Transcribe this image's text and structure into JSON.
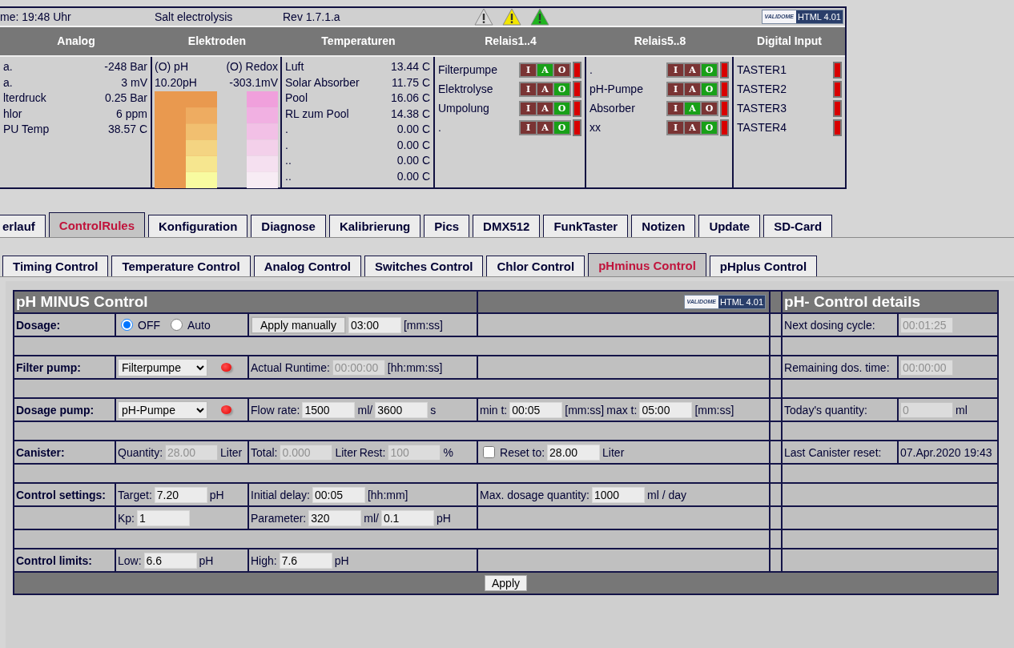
{
  "status_bar": {
    "time": "me: 19:48 Uhr",
    "title": "Salt electrolysis",
    "revision": "Rev 1.7.1.a",
    "alerts": [
      {
        "color": "#d9d9d9"
      },
      {
        "color": "#f2e600"
      },
      {
        "color": "#1fb41f"
      }
    ],
    "badge": {
      "logo": "VALIDOME",
      "version": "HTML 4.01"
    }
  },
  "panels": {
    "headers": [
      "Analog",
      "Elektroden",
      "Temperaturen",
      "Relais1..4",
      "Relais5..8",
      "Digital Input"
    ],
    "analog": [
      {
        "name": "a.",
        "value": "-248 Bar"
      },
      {
        "name": "a.",
        "value": "3 mV"
      },
      {
        "name": "lterdruck",
        "value": "0.25 Bar"
      },
      {
        "name": "hlor",
        "value": "6 ppm"
      },
      {
        "name": "PU Temp",
        "value": "38.57 C"
      }
    ],
    "electrodes": {
      "ph_label": "(O) pH",
      "redox_label": "(O) Redox",
      "ph_value": "10.20pH",
      "redox_value": "-303.1mV"
    },
    "temperatures": [
      {
        "name": "Luft",
        "value": "13.44 C"
      },
      {
        "name": "Solar Absorber",
        "value": "11.75 C"
      },
      {
        "name": "Pool",
        "value": "16.06 C"
      },
      {
        "name": "RL zum Pool",
        "value": "14.38 C"
      },
      {
        "name": ".",
        "value": "0.00 C"
      },
      {
        "name": ".",
        "value": "0.00 C"
      },
      {
        "name": "..",
        "value": "0.00 C"
      },
      {
        "name": "..",
        "value": "0.00 C"
      }
    ],
    "relays_1_4": [
      {
        "name": "Filterpumpe",
        "active": false,
        "modes": [
          {
            "label": "I",
            "selected": false
          },
          {
            "label": "A",
            "selected": true
          },
          {
            "label": "O",
            "selected": false
          }
        ]
      },
      {
        "name": "Elektrolyse",
        "active": false,
        "modes": [
          {
            "label": "I",
            "selected": false
          },
          {
            "label": "A",
            "selected": false
          },
          {
            "label": "O",
            "selected": true
          }
        ]
      },
      {
        "name": "Umpolung",
        "active": false,
        "modes": [
          {
            "label": "I",
            "selected": false
          },
          {
            "label": "A",
            "selected": false
          },
          {
            "label": "O",
            "selected": true
          }
        ]
      },
      {
        "name": ".",
        "active": false,
        "modes": [
          {
            "label": "I",
            "selected": false
          },
          {
            "label": "A",
            "selected": false
          },
          {
            "label": "O",
            "selected": true
          }
        ]
      }
    ],
    "relays_5_8": [
      {
        "name": ".",
        "active": false,
        "modes": [
          {
            "label": "I",
            "selected": false
          },
          {
            "label": "A",
            "selected": false
          },
          {
            "label": "O",
            "selected": true
          }
        ]
      },
      {
        "name": "pH-Pumpe",
        "active": false,
        "modes": [
          {
            "label": "I",
            "selected": false
          },
          {
            "label": "A",
            "selected": false
          },
          {
            "label": "O",
            "selected": true
          }
        ]
      },
      {
        "name": "Absorber",
        "active": false,
        "modes": [
          {
            "label": "I",
            "selected": false
          },
          {
            "label": "A",
            "selected": true
          },
          {
            "label": "O",
            "selected": false
          }
        ]
      },
      {
        "name": "xx",
        "active": false,
        "modes": [
          {
            "label": "I",
            "selected": false
          },
          {
            "label": "A",
            "selected": false
          },
          {
            "label": "O",
            "selected": true
          }
        ]
      }
    ],
    "digital_inputs": [
      {
        "name": "TASTER1",
        "active": false
      },
      {
        "name": "TASTER2",
        "active": false
      },
      {
        "name": "TASTER3",
        "active": false
      },
      {
        "name": "TASTER4",
        "active": false
      }
    ]
  },
  "main_tabs": [
    {
      "label": "erlauf",
      "selected": false
    },
    {
      "label": "ControlRules",
      "selected": true
    },
    {
      "label": "Konfiguration",
      "selected": false
    },
    {
      "label": "Diagnose",
      "selected": false
    },
    {
      "label": "Kalibrierung",
      "selected": false
    },
    {
      "label": "Pics",
      "selected": false
    },
    {
      "label": "DMX512",
      "selected": false
    },
    {
      "label": "FunkTaster",
      "selected": false
    },
    {
      "label": "Notizen",
      "selected": false
    },
    {
      "label": "Update",
      "selected": false
    },
    {
      "label": "SD-Card",
      "selected": false
    }
  ],
  "sub_tabs": [
    {
      "label": "Timing Control",
      "selected": false
    },
    {
      "label": "Temperature Control",
      "selected": false
    },
    {
      "label": "Analog Control",
      "selected": false
    },
    {
      "label": "Switches Control",
      "selected": false
    },
    {
      "label": "Chlor Control",
      "selected": false
    },
    {
      "label": "pHminus Control",
      "selected": true
    },
    {
      "label": "pHplus Control",
      "selected": false
    }
  ],
  "form": {
    "title": "pH MINUS Control",
    "badge": {
      "logo": "VALIDOME",
      "version": "HTML 4.01"
    },
    "details_title": "pH- Control details",
    "apply": "Apply",
    "rows": [
      {
        "kind": "fields",
        "label": "Dosage:",
        "column_2": [
          {
            "kind": "radio",
            "label": "OFF",
            "selected": true
          },
          {
            "kind": "radio",
            "label": "Auto",
            "selected": false
          }
        ],
        "column_3": [
          {
            "kind": "button",
            "label": "Apply manually"
          },
          {
            "kind": "input",
            "value": "03:00",
            "disabled": false
          },
          {
            "kind": "text",
            "text": "[mm:ss]"
          }
        ],
        "detail": {
          "label": "Next dosing cycle:",
          "items": [
            {
              "kind": "input",
              "value": "00:01:25",
              "disabled": true
            }
          ]
        }
      },
      {
        "kind": "spacer"
      },
      {
        "kind": "fields",
        "label": "Filter pump:",
        "column_2": [
          {
            "kind": "select",
            "value": "Filterpumpe"
          },
          {
            "kind": "led",
            "on": false
          }
        ],
        "column_3": [
          {
            "kind": "text",
            "text": "Actual Runtime:"
          },
          {
            "kind": "input",
            "value": "00:00:00",
            "disabled": true
          },
          {
            "kind": "text",
            "text": "[hh:mm:ss]"
          }
        ],
        "detail": {
          "label": "Remaining dos. time:",
          "items": [
            {
              "kind": "input",
              "value": "00:00:00",
              "disabled": true
            }
          ]
        }
      },
      {
        "kind": "spacer"
      },
      {
        "kind": "fields",
        "label": "Dosage pump:",
        "column_2": [
          {
            "kind": "select",
            "value": "pH-Pumpe"
          },
          {
            "kind": "led",
            "on": false
          }
        ],
        "column_3": [
          {
            "kind": "text",
            "text": "Flow rate:"
          },
          {
            "kind": "input",
            "value": "1500",
            "disabled": false
          },
          {
            "kind": "text",
            "text": "ml/"
          },
          {
            "kind": "input",
            "value": "3600",
            "disabled": false
          },
          {
            "kind": "text",
            "text": "s"
          }
        ],
        "column_4": [
          {
            "kind": "text",
            "text": "min t:"
          },
          {
            "kind": "input",
            "value": "00:05",
            "disabled": false
          },
          {
            "kind": "text",
            "text": "[mm:ss]"
          },
          {
            "kind": "text",
            "text": "max t:"
          },
          {
            "kind": "input",
            "value": "05:00",
            "disabled": false
          },
          {
            "kind": "text",
            "text": "[mm:ss]"
          }
        ],
        "detail": {
          "label": "Today's quantity:",
          "items": [
            {
              "kind": "input",
              "value": "0",
              "disabled": true
            },
            {
              "kind": "text",
              "text": "ml"
            }
          ]
        }
      },
      {
        "kind": "spacer"
      },
      {
        "kind": "fields",
        "label": "Canister:",
        "column_2": [
          {
            "kind": "text",
            "text": "Quantity:"
          },
          {
            "kind": "input",
            "value": "28.00",
            "disabled": true
          },
          {
            "kind": "text",
            "text": "Liter"
          }
        ],
        "column_3": [
          {
            "kind": "text",
            "text": "Total:"
          },
          {
            "kind": "input",
            "value": "0.000",
            "disabled": true
          },
          {
            "kind": "text",
            "text": "Liter"
          },
          {
            "kind": "text",
            "text": "Rest:"
          },
          {
            "kind": "input",
            "value": "100",
            "disabled": true
          },
          {
            "kind": "text",
            "text": "%"
          }
        ],
        "column_4": [
          {
            "kind": "checkbox",
            "checked": false
          },
          {
            "kind": "text",
            "text": "Reset to:"
          },
          {
            "kind": "input",
            "value": "28.00",
            "disabled": false
          },
          {
            "kind": "text",
            "text": "Liter"
          }
        ],
        "detail": {
          "label": "Last Canister reset:",
          "items": [
            {
              "kind": "text",
              "text": "07.Apr.2020 19:43"
            }
          ]
        }
      },
      {
        "kind": "spacer"
      },
      {
        "kind": "fields",
        "label": "Control settings:",
        "column_2": [
          {
            "kind": "text",
            "text": "Target:"
          },
          {
            "kind": "input",
            "value": "7.20",
            "disabled": false
          },
          {
            "kind": "text",
            "text": "pH"
          }
        ],
        "column_3": [
          {
            "kind": "text",
            "text": "Initial delay:"
          },
          {
            "kind": "input",
            "value": "00:05",
            "disabled": false
          },
          {
            "kind": "text",
            "text": "[hh:mm]"
          }
        ],
        "column_4": [
          {
            "kind": "text",
            "text": "Max. dosage quantity:"
          },
          {
            "kind": "input",
            "value": "1000",
            "disabled": false
          },
          {
            "kind": "text",
            "text": "ml / day"
          }
        ]
      },
      {
        "kind": "fields",
        "column_2": [
          {
            "kind": "text",
            "text": "Kp:"
          },
          {
            "kind": "input",
            "value": "1",
            "disabled": false
          }
        ],
        "column_3": [
          {
            "kind": "text",
            "text": "Parameter:"
          },
          {
            "kind": "input",
            "value": "320",
            "disabled": false
          },
          {
            "kind": "text",
            "text": "ml/"
          },
          {
            "kind": "input",
            "value": "0.1",
            "disabled": false
          },
          {
            "kind": "text",
            "text": "pH"
          }
        ]
      },
      {
        "kind": "spacer"
      },
      {
        "kind": "fields",
        "label": "Control limits:",
        "column_2": [
          {
            "kind": "text",
            "text": "Low:"
          },
          {
            "kind": "input",
            "value": "6.6",
            "disabled": false
          },
          {
            "kind": "text",
            "text": "pH"
          }
        ],
        "column_3": [
          {
            "kind": "text",
            "text": "High:"
          },
          {
            "kind": "input",
            "value": "7.6",
            "disabled": false
          },
          {
            "kind": "text",
            "text": "pH"
          }
        ]
      }
    ]
  }
}
